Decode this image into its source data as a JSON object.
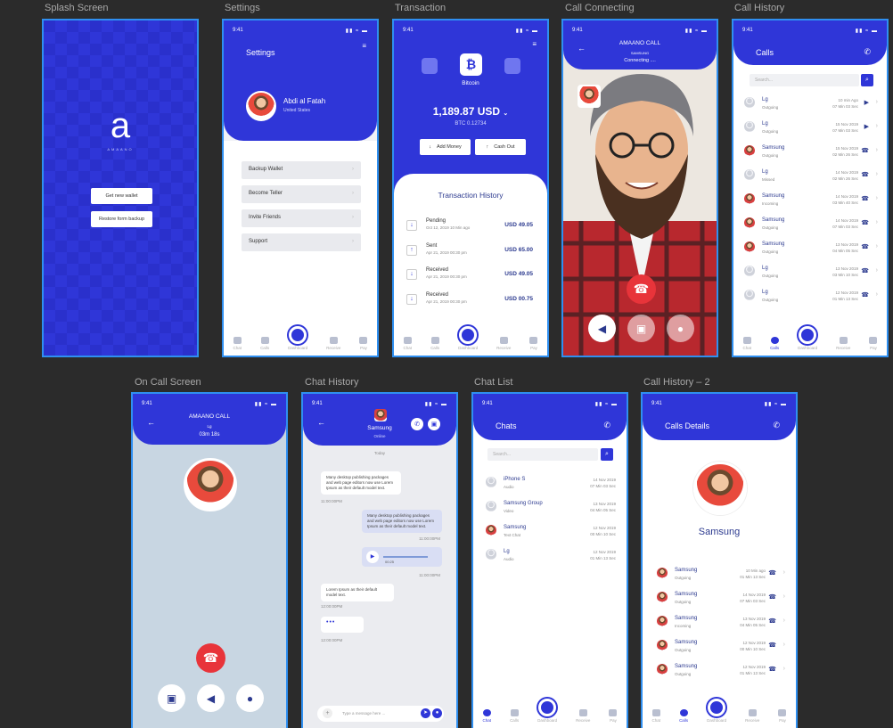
{
  "labels": {
    "splash": "Splash Screen",
    "settings": "Settings",
    "transaction": "Transaction",
    "call_connecting": "Call Connecting",
    "call_history": "Call History",
    "on_call": "On Call Screen",
    "chat_history": "Chat History",
    "chat_list": "Chat List",
    "call_history_2": "Call History – 2"
  },
  "status": {
    "time": "9:41",
    "icons": "▮▮ ≈ ▬"
  },
  "splash": {
    "logo": "a",
    "logo_sub": "AMAANO",
    "btn_new": "Get new wallet",
    "btn_restore": "Restore form backup"
  },
  "settings": {
    "title": "Settings",
    "name": "Abdi al Fatah",
    "country": "United States",
    "menu": [
      "Backup Wallet",
      "Become Teller",
      "Invite Friends",
      "Support"
    ]
  },
  "nav": {
    "chat": "Chat",
    "calls": "Calls",
    "dashboard": "Dashboard",
    "receive": "Receive",
    "pay": "Pay"
  },
  "transaction": {
    "coin": "Bitcoin",
    "amount": "1,189.87 USD",
    "btc": "BTC 0.12734",
    "add": "Add Money",
    "cash": "Cash Out",
    "history_title": "Transaction History",
    "items": [
      {
        "name": "Pending",
        "date": "Oct 12, 2019 10 Min ago",
        "value": "USD 49.05",
        "icon": "↓"
      },
      {
        "name": "Sent",
        "date": "Apr 21, 2019 00:30 pm",
        "value": "USD 65.00",
        "icon": "↑"
      },
      {
        "name": "Received",
        "date": "Apr 21, 2019 00:30 pm",
        "value": "USD 49.05",
        "icon": "↓"
      },
      {
        "name": "Received",
        "date": "Apr 21, 2019 00:30 pm",
        "value": "USD 00.75",
        "icon": "↓"
      }
    ]
  },
  "connecting": {
    "title": "AMAANO CALL",
    "who": "SAMSUNG",
    "state": "Connecting ...."
  },
  "call_history": {
    "title": "Calls",
    "search_placeholder": "Search...",
    "items": [
      {
        "name": "Lg",
        "sub": "Outgoing",
        "d1": "10 min Ago",
        "d2": "07 Min 03 Sec",
        "icon": "▶"
      },
      {
        "name": "Lg",
        "sub": "Outgoing",
        "d1": "15 Nov 2019",
        "d2": "07 Min 03 Sec",
        "icon": "▶"
      },
      {
        "name": "Samsung",
        "sub": "Outgoing",
        "d1": "15 Nov 2019",
        "d2": "02 Min 26 Sec",
        "icon": "☎"
      },
      {
        "name": "Lg",
        "sub": "Missed",
        "d1": "14 Nov 2019",
        "d2": "02 Min 26 Sec",
        "icon": "☎"
      },
      {
        "name": "Samsung",
        "sub": "Incoming",
        "d1": "14 Nov 2019",
        "d2": "03 Min 40 Sec",
        "icon": "☎"
      },
      {
        "name": "Samsung",
        "sub": "Outgoing",
        "d1": "14 Nov 2019",
        "d2": "07 Min 03 Sec",
        "icon": "☎"
      },
      {
        "name": "Samsung",
        "sub": "Outgoing",
        "d1": "13 Nov 2019",
        "d2": "04 Min 05 Sec",
        "icon": "☎"
      },
      {
        "name": "Lg",
        "sub": "Outgoing",
        "d1": "13 Nov 2019",
        "d2": "03 Min 10 Sec",
        "icon": "☎"
      },
      {
        "name": "Lg",
        "sub": "Outgoing",
        "d1": "12 Nov 2019",
        "d2": "01 Min 13 Sec",
        "icon": "☎"
      }
    ]
  },
  "on_call": {
    "title": "AMAANO CALL",
    "who": "Lg",
    "time": "03m 18s"
  },
  "chat_history": {
    "name": "Samsung",
    "status": "Online",
    "today": "Today",
    "msg1": "Many desktop publishing packages and web page editors now use Lorem Ipsum as their default model text.",
    "t1": "11:00:00PM",
    "msg2": "Many desktop publishing packages and web page editors now use Lorem Ipsum as their default model text.",
    "t2": "11:00:00PM",
    "voice": "00:25",
    "t3": "11:00:00PM",
    "msg3": "Lorem Ipsum as their default model text.",
    "t4": "12:00:00PM",
    "t5": "12:00:00PM",
    "input_placeholder": "Type a message here ..."
  },
  "chat_list": {
    "title": "Chats",
    "search_placeholder": "Search...",
    "items": [
      {
        "name": "iPhone S",
        "sub": "Audio",
        "d1": "14 Nov 2019",
        "d2": "07 Min 03 Sec"
      },
      {
        "name": "Samsung Group",
        "sub": "Video",
        "d1": "13 Nov 2019",
        "d2": "04 Min 05 Sec"
      },
      {
        "name": "Samsung",
        "sub": "Text Chat",
        "d1": "12 Nov 2019",
        "d2": "00 Min 10 Sec"
      },
      {
        "name": "Lg",
        "sub": "Audio",
        "d1": "12 Nov 2019",
        "d2": "01 Min 13 Sec"
      }
    ]
  },
  "calls_details": {
    "title": "Calls Details",
    "name": "Samsung",
    "items": [
      {
        "name": "Samsung",
        "sub": "Outgoing",
        "d1": "10 Min ago",
        "d2": "01 Min 13 Sec"
      },
      {
        "name": "Samsung",
        "sub": "Outgoing",
        "d1": "14 Nov 2019",
        "d2": "07 Min 03 Sec"
      },
      {
        "name": "Samsung",
        "sub": "Incoming",
        "d1": "13 Nov 2019",
        "d2": "04 Min 05 Sec"
      },
      {
        "name": "Samsung",
        "sub": "Outgoing",
        "d1": "12 Nov 2019",
        "d2": "00 Min 10 Sec"
      },
      {
        "name": "Samsung",
        "sub": "Outgoing",
        "d1": "12 Nov 2019",
        "d2": "01 Min 13 Sec"
      }
    ]
  },
  "colors": {
    "primary": "#2f36d8",
    "danger": "#e8343a",
    "frame": "#2f8ff0"
  }
}
